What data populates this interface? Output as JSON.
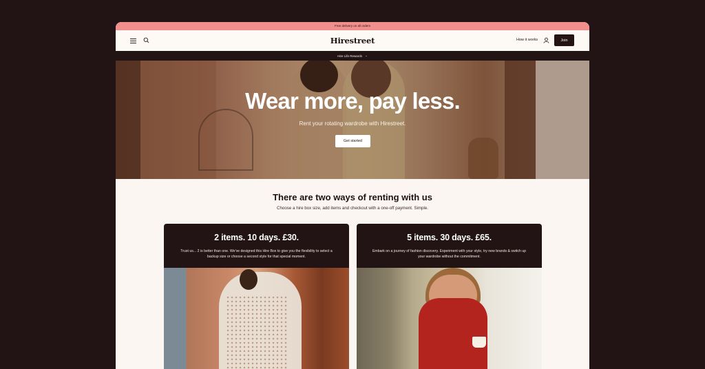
{
  "promo": {
    "text": "Free delivery on all orders"
  },
  "header": {
    "logo": "Hirestreet",
    "how_it_works": "How it works",
    "join": "Join"
  },
  "subnav": {
    "label": "Hire Life Rewards",
    "chevron": "⌄"
  },
  "hero": {
    "title": "Wear more, pay less.",
    "subtitle": "Rent your rotating wardrobe with Hirestreet.",
    "cta": "Get started"
  },
  "section": {
    "title": "There are two ways of renting with us",
    "subtitle": "Choose a hire box size, add items and checkout with a one-off payment. Simple."
  },
  "cards": [
    {
      "title": "2 items. 10 days. £30.",
      "description": "Trust us... 2 is better than one. We've designed this Hire Box to give you the flexibility to select a backup size or choose a second style for that special moment."
    },
    {
      "title": "5 items. 30 days. £65.",
      "description": "Embark on a journey of fashion discovery. Experiment with your style, try new brands & switch up your wardrobe without the commitment."
    }
  ],
  "icons": {
    "menu": "hamburger-menu-icon",
    "search": "search-icon",
    "user": "user-icon"
  },
  "colors": {
    "promo_bg": "#f08f8c",
    "dark": "#221414",
    "cream": "#fbf6f1"
  }
}
